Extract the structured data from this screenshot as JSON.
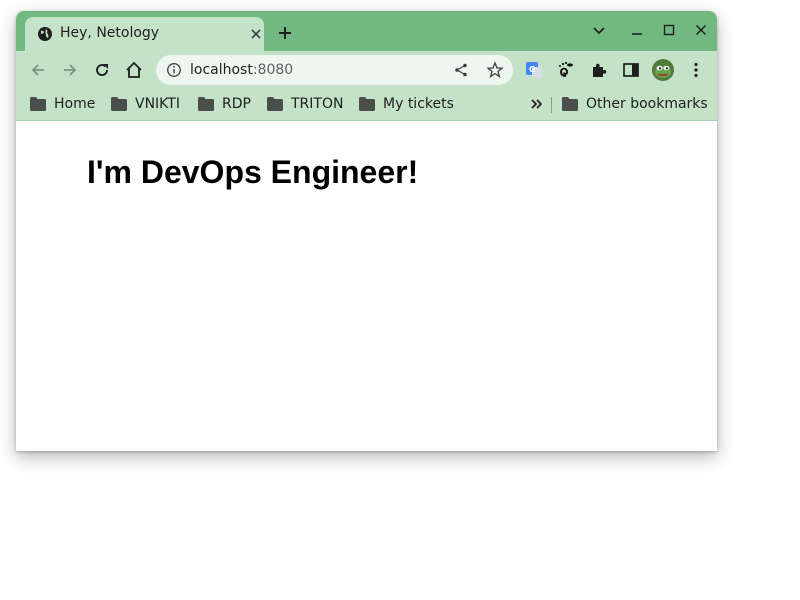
{
  "browser": {
    "tab": {
      "title": "Hey, Netology"
    },
    "address": {
      "host": "localhost",
      "port": ":8080"
    },
    "colors": {
      "frame": "#72b981",
      "toolbar": "#c3e2c8"
    }
  },
  "bookmarks": {
    "items": [
      {
        "label": "Home"
      },
      {
        "label": "VNIKTI"
      },
      {
        "label": "RDP"
      },
      {
        "label": "TRITON"
      },
      {
        "label": "My tickets"
      }
    ],
    "other": "Other bookmarks"
  },
  "page": {
    "heading": "I'm DevOps Engineer!"
  }
}
